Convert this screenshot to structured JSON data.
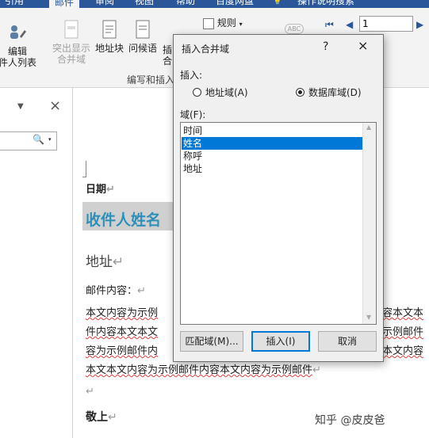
{
  "ribbon": {
    "tabs": [
      "引用",
      "邮件",
      "审阅",
      "视图",
      "帮助",
      "百度网盘",
      "操作说明搜索"
    ],
    "active_tab": "邮件",
    "edit_recipients": [
      "编辑",
      "件人列表"
    ],
    "highlight_merge_fields": [
      "突出显示",
      "合并域"
    ],
    "address_block": "地址块",
    "greeting_line": "问候语",
    "insert_merge_field_partial": [
      "插",
      "合"
    ],
    "rules": "规则",
    "group_label": "编写和插入",
    "record_number": "1",
    "preview_label": "ABC"
  },
  "navpane": {
    "close": "×"
  },
  "document": {
    "date": "日期",
    "recipient_name": "收件人姓名",
    "address": "地址",
    "content_label": "邮件内容：",
    "body_lines": [
      "本文内容为示例",
      "件内容本文本文",
      "容为示例邮件内",
      "本文本文内容为示例邮件内容本文内容为示例邮件"
    ],
    "body_lines_right": [
      "容本文本",
      "示例邮件",
      "本文内容"
    ],
    "closing": "敬上"
  },
  "dialog": {
    "title": "插入合并域",
    "help": "?",
    "close": "×",
    "insert_label": "插入:",
    "option_address": "地址域(A)",
    "option_database": "数据库域(D)",
    "selected_option": "database",
    "fields_label": "域(F):",
    "fields": [
      "时间",
      "姓名",
      "称呼",
      "地址"
    ],
    "selected_field": "姓名",
    "buttons": {
      "match": "匹配域(M)...",
      "insert": "插入(I)",
      "cancel": "取消"
    }
  },
  "watermark": "知乎 @皮皮爸"
}
